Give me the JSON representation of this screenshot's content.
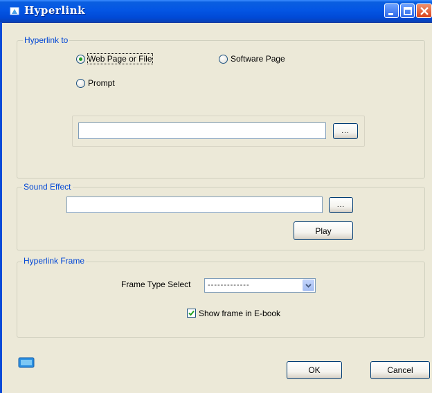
{
  "window": {
    "title": "Hyperlink",
    "icon": "book-icon"
  },
  "hyperlink_to": {
    "legend": "Hyperlink to",
    "options": [
      {
        "label": "Web Page or File",
        "checked": true
      },
      {
        "label": "Software Page",
        "checked": false
      },
      {
        "label": "Prompt",
        "checked": false
      }
    ],
    "path_value": "",
    "browse_label": "..."
  },
  "sound_effect": {
    "legend": "Sound Effect",
    "path_value": "",
    "browse_label": "...",
    "play_label": "Play"
  },
  "hyperlink_frame": {
    "legend": "Hyperlink Frame",
    "frame_type_label": "Frame Type Select",
    "frame_type_value": "-------------",
    "show_frame_label": "Show frame in E-book",
    "show_frame_checked": true
  },
  "footer": {
    "ok_label": "OK",
    "cancel_label": "Cancel"
  },
  "colors": {
    "titlebar": "#0456E4",
    "legend": "#0046D5",
    "dialog_bg": "#ECE9D8"
  }
}
